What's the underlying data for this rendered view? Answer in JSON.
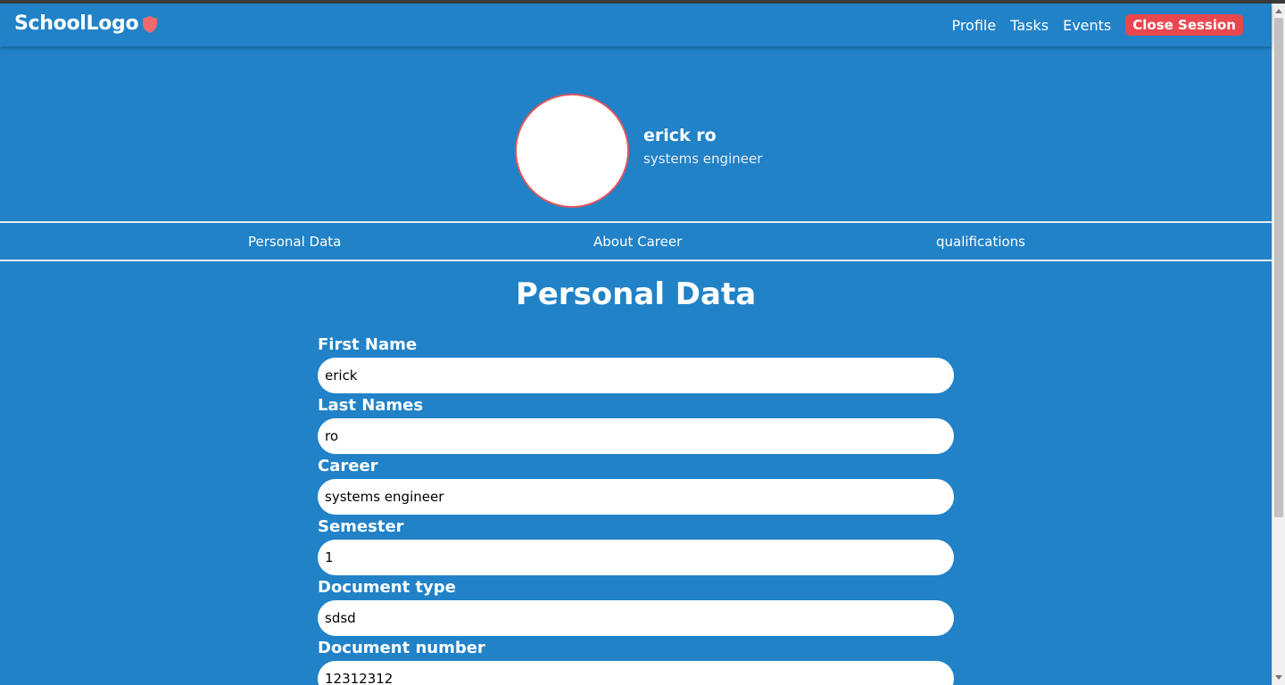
{
  "header": {
    "brand": "SchoolLogo",
    "nav": [
      "Profile",
      "Tasks",
      "Events"
    ],
    "close_session": "Close Session"
  },
  "profile": {
    "name": "erick ro",
    "career": "systems engineer"
  },
  "tabs": [
    "Personal Data",
    "About Career",
    "qualifications"
  ],
  "section": {
    "title": "Personal Data"
  },
  "form": {
    "fields": [
      {
        "label": "First Name",
        "value": "erick"
      },
      {
        "label": "Last Names",
        "value": "ro"
      },
      {
        "label": "Career",
        "value": "systems engineer"
      },
      {
        "label": "Semester",
        "value": "1"
      },
      {
        "label": "Document type",
        "value": "sdsd"
      },
      {
        "label": "Document number",
        "value": "12312312"
      }
    ]
  },
  "colors": {
    "background": "#2182c8",
    "accent_red": "#e8474f",
    "shield": "#f06a6f"
  },
  "icons": {
    "brand_icon": "shield-icon"
  }
}
